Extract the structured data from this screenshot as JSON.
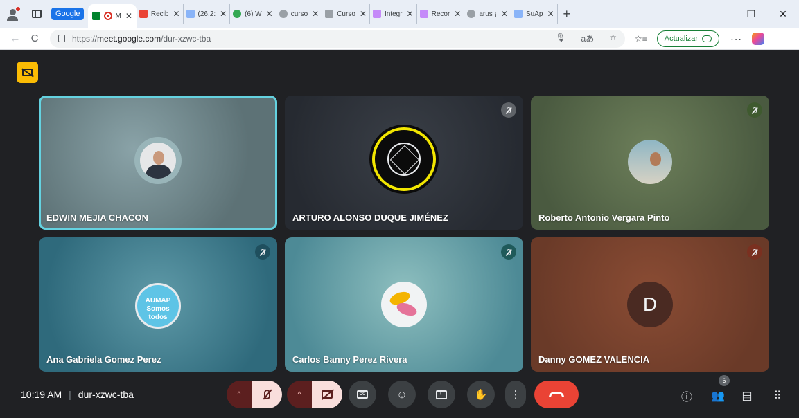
{
  "browser": {
    "tab_group": "Google",
    "tabs": [
      {
        "label": "M",
        "fav": "#34a853",
        "active": true
      },
      {
        "label": "Recib",
        "fav": "#ea4335"
      },
      {
        "label": "(26.2:",
        "fav": "#8ab4f8"
      },
      {
        "label": "(6) W",
        "fav": "#34a853"
      },
      {
        "label": "curso",
        "fav": "#9aa0a6"
      },
      {
        "label": "Curso",
        "fav": "#9aa0a6"
      },
      {
        "label": "Integr",
        "fav": "#c58af9"
      },
      {
        "label": "Recor",
        "fav": "#c58af9"
      },
      {
        "label": "arus ¡",
        "fav": "#9aa0a6"
      },
      {
        "label": "SuAp",
        "fav": "#8ab4f8"
      }
    ],
    "close_glyph": "✕",
    "new_tab": "+",
    "window_controls": {
      "minimize": "—",
      "restore": "❐",
      "close": "✕"
    },
    "nav": {
      "back": "←",
      "reload": "C"
    },
    "url_prefix": "https://",
    "url_host": "meet.google.com",
    "url_path": "/dur-xzwc-tba",
    "omnibox_icons": [
      "🎙",
      "aあ",
      "☆"
    ],
    "favorites_icon": "☆≡",
    "update_button": "Actualizar",
    "menu": "···"
  },
  "meet": {
    "participants": [
      {
        "name": "EDWIN MEJIA CHACON",
        "speaking": true,
        "muted": false
      },
      {
        "name": "ARTURO ALONSO DUQUE JIMÉNEZ",
        "muted": true,
        "mute_color": "#5f6368"
      },
      {
        "name": "Roberto Antonio Vergara Pinto",
        "muted": true,
        "mute_color": "#3f5a2f"
      },
      {
        "name": "Ana Gabriela Gomez Perez",
        "muted": true,
        "mute_color": "#1f4f5e",
        "avatar_text": "AUMAP Somos todos"
      },
      {
        "name": "Carlos Banny Perez Rivera",
        "muted": true,
        "mute_color": "#1f5a5a"
      },
      {
        "name": "Danny GOMEZ VALENCIA",
        "muted": true,
        "mute_color": "#7a3020",
        "initial": "D"
      }
    ],
    "time": "10:19 AM",
    "meeting_code": "dur-xzwc-tba",
    "controls": {
      "caret": "^",
      "emoji": "☺",
      "raise_hand": "✋",
      "more": "⋮"
    },
    "right": {
      "info": "ⓘ",
      "people": "👥",
      "people_count": "6",
      "chat": "▤",
      "activities": "⠿"
    },
    "colors": {
      "accent_speaking": "#64d2e0",
      "hangup": "#ea4335",
      "capture_badge": "#fbbc04"
    }
  }
}
